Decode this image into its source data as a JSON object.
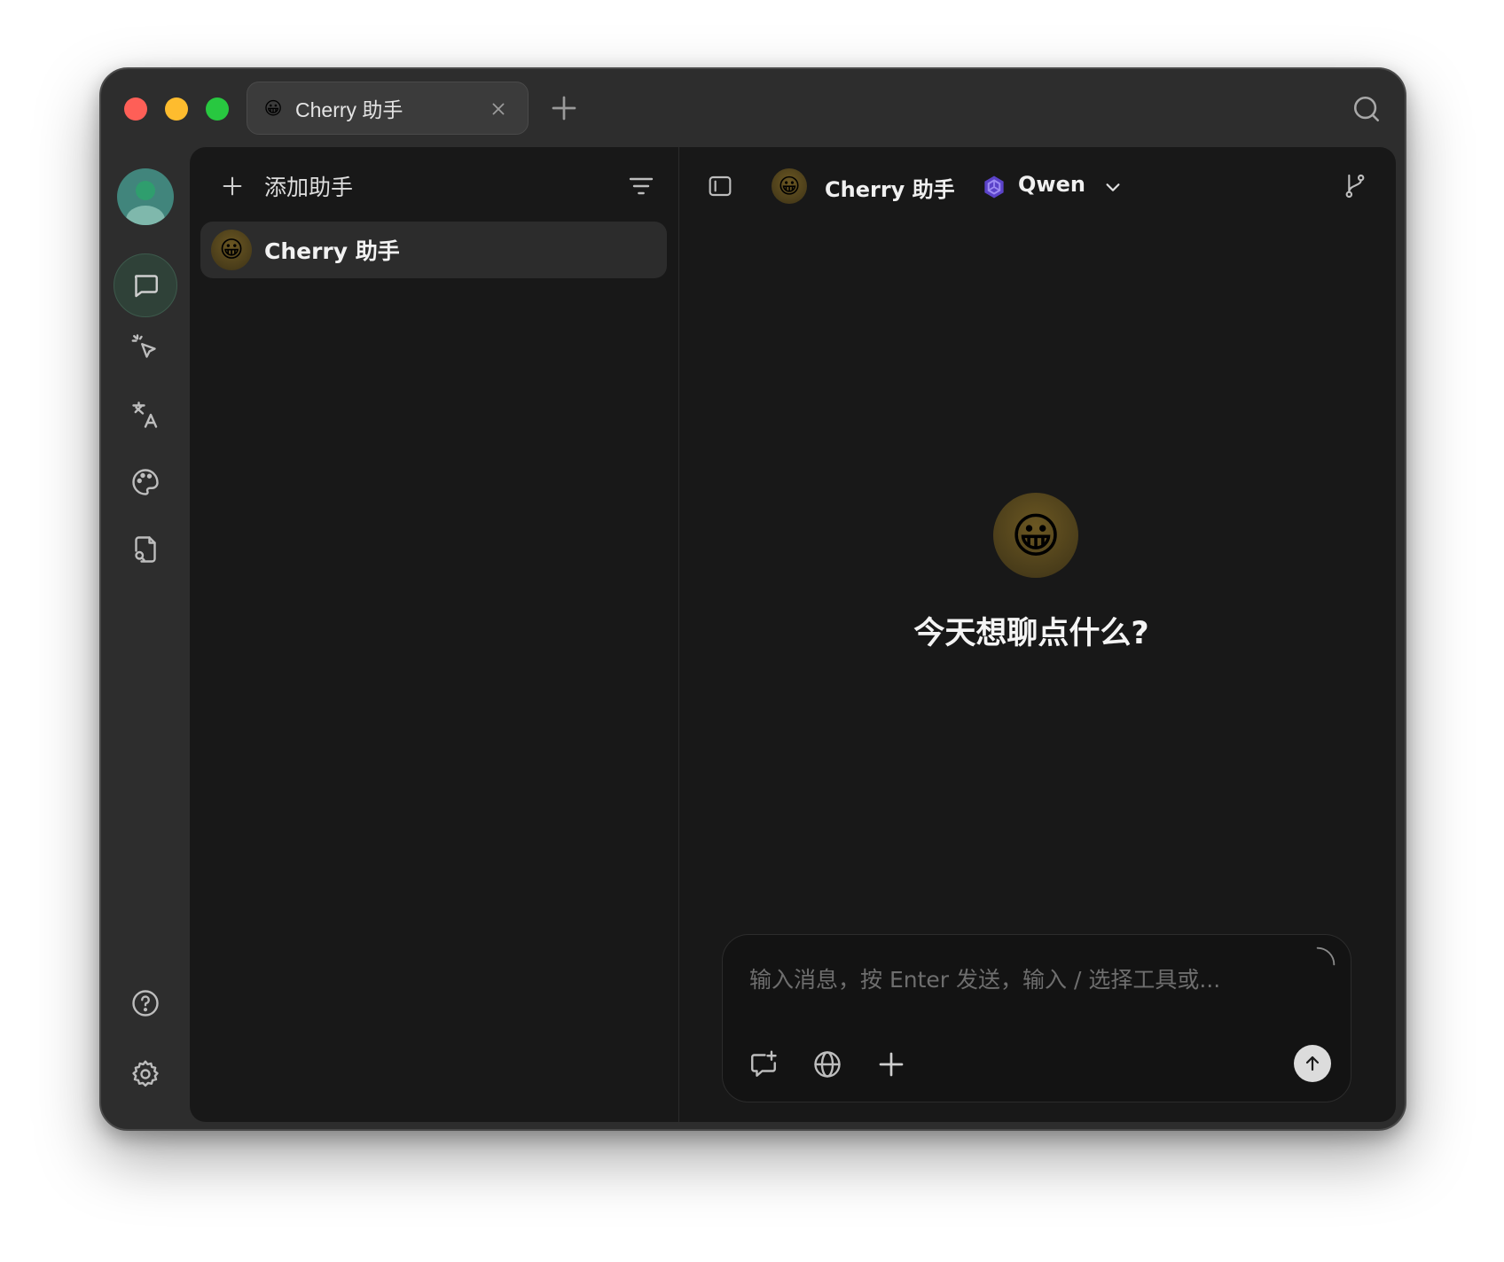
{
  "window": {
    "tab": {
      "emoji": "😀",
      "title": "Cherry 助手"
    }
  },
  "sidebar": {
    "items": [
      {
        "name": "chat",
        "icon": "chat-bubble-icon",
        "active": true
      },
      {
        "name": "agents",
        "icon": "sparkle-cursor-icon",
        "active": false
      },
      {
        "name": "translate",
        "icon": "translate-icon",
        "active": false
      },
      {
        "name": "paintings",
        "icon": "palette-icon",
        "active": false
      },
      {
        "name": "files",
        "icon": "file-search-icon",
        "active": false
      }
    ],
    "bottom": [
      {
        "name": "help",
        "icon": "help-icon"
      },
      {
        "name": "settings",
        "icon": "gear-icon"
      }
    ]
  },
  "assistants": {
    "add_label": "添加助手",
    "list": [
      {
        "emoji": "😀",
        "name": "Cherry 助手",
        "selected": true
      }
    ]
  },
  "chat": {
    "header": {
      "emoji": "😀",
      "title": "Cherry 助手",
      "model": "Qwen"
    },
    "welcome": {
      "emoji": "😀",
      "text": "今天想聊点什么?"
    },
    "composer": {
      "placeholder": "输入消息，按 Enter 发送，输入 / 选择工具或..."
    }
  },
  "colors": {
    "window_bg": "#2d2d2d",
    "content_bg": "#181818",
    "active_nav": "#2f4138",
    "avatar": "#41857c",
    "model_icon": "#6b4fdc"
  }
}
